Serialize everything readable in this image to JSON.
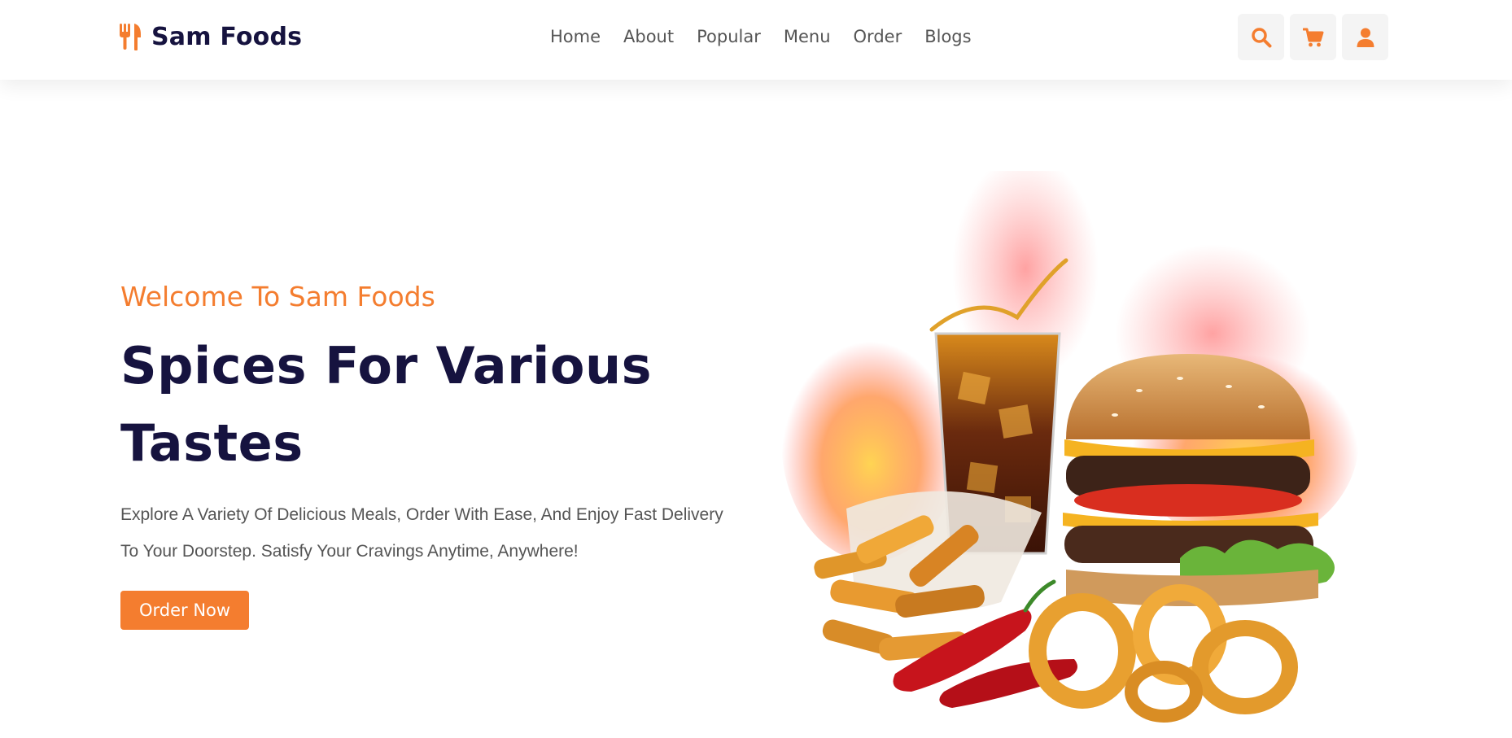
{
  "brand": {
    "name": "Sam Foods",
    "icon": "utensils-icon"
  },
  "nav": {
    "links": [
      "Home",
      "About",
      "Popular",
      "Menu",
      "Order",
      "Blogs"
    ]
  },
  "actions": {
    "search_icon": "search-icon",
    "cart_icon": "cart-icon",
    "user_icon": "user-icon"
  },
  "hero": {
    "subtitle": "Welcome To Sam Foods",
    "headline_line1": "Spices For Various",
    "headline_line2": "Tastes",
    "description_line1": "Explore A Variety Of Delicious Meals, Order With Ease, And Enjoy Fast Delivery",
    "description_line2": "To Your Doorstep. Satisfy Your Cravings Anytime, Anywhere!",
    "cta_label": "Order Now"
  },
  "colors": {
    "accent": "#f47d2f",
    "heading": "#16133f",
    "body_text": "#555555",
    "icon_bg": "#f4f4f4"
  }
}
